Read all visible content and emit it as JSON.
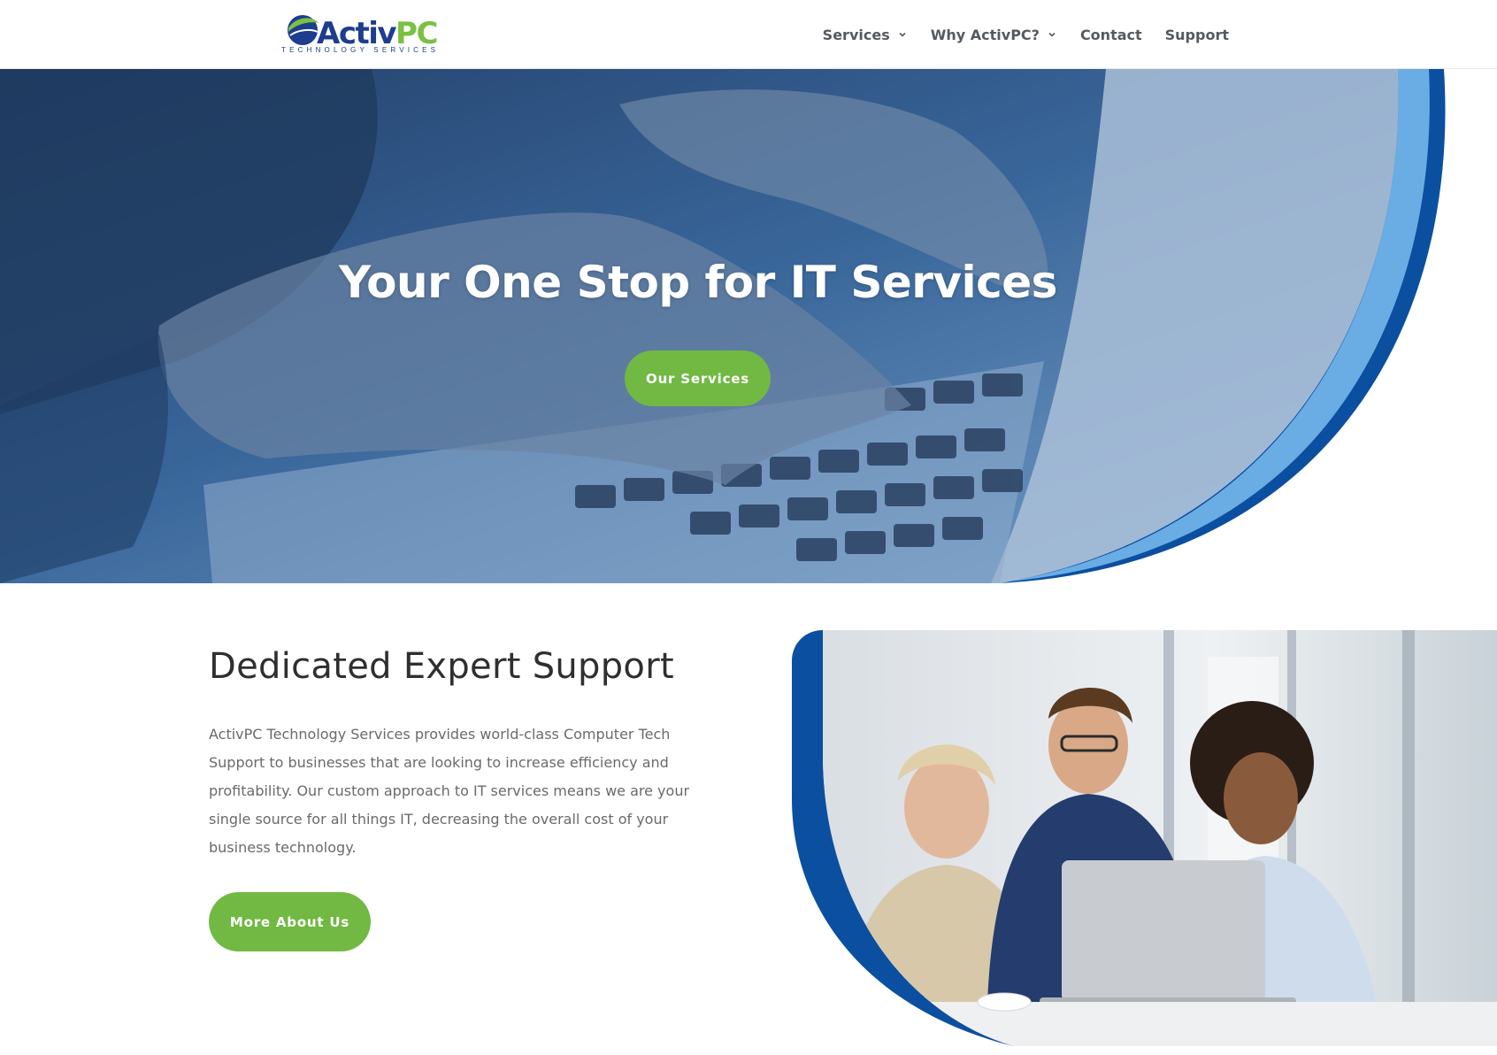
{
  "brand": {
    "name_part1": "Activ",
    "name_part2": "PC",
    "tagline": "TECHNOLOGY SERVICES",
    "colors": {
      "navy": "#1d3d8f",
      "green": "#7ac143",
      "accent_blue": "#0b4fa0",
      "light_blue": "#6aace4"
    }
  },
  "nav": {
    "items": [
      {
        "label": "Services",
        "has_dropdown": true
      },
      {
        "label": "Why ActivPC?",
        "has_dropdown": true
      },
      {
        "label": "Contact",
        "has_dropdown": false
      },
      {
        "label": "Support",
        "has_dropdown": false
      }
    ]
  },
  "hero": {
    "title": "Your One Stop for IT Services",
    "button_label": "Our Services"
  },
  "about": {
    "title": "Dedicated Expert Support",
    "body": "ActivPC Technology Services provides world-class Computer Tech Support to businesses that are looking to increase efficiency and profitability. Our custom approach to IT services means we are your single source for all things IT, decreasing the overall cost of your business technology.",
    "button_label": "More About Us"
  },
  "icons": [
    "chevron-down-icon",
    "logo-globe-icon"
  ]
}
